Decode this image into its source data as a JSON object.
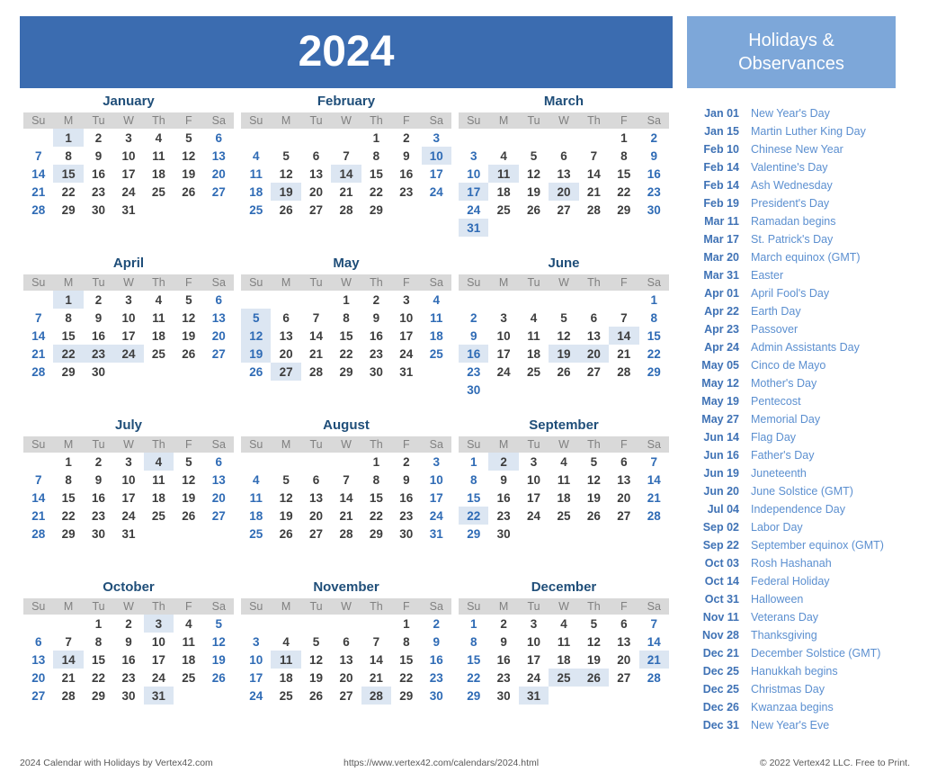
{
  "header": {
    "year": "2024"
  },
  "sidebar": {
    "title_line1": "Holidays &",
    "title_line2": "Observances",
    "holidays": [
      {
        "date": "Jan 01",
        "name": "New Year's Day"
      },
      {
        "date": "Jan 15",
        "name": "Martin Luther King Day"
      },
      {
        "date": "Feb 10",
        "name": "Chinese New Year"
      },
      {
        "date": "Feb 14",
        "name": "Valentine's Day"
      },
      {
        "date": "Feb 14",
        "name": "Ash Wednesday"
      },
      {
        "date": "Feb 19",
        "name": "President's Day"
      },
      {
        "date": "Mar 11",
        "name": "Ramadan begins"
      },
      {
        "date": "Mar 17",
        "name": "St. Patrick's Day"
      },
      {
        "date": "Mar 20",
        "name": "March equinox (GMT)"
      },
      {
        "date": "Mar 31",
        "name": "Easter"
      },
      {
        "date": "Apr 01",
        "name": "April Fool's Day"
      },
      {
        "date": "Apr 22",
        "name": "Earth Day"
      },
      {
        "date": "Apr 23",
        "name": "Passover"
      },
      {
        "date": "Apr 24",
        "name": "Admin Assistants Day"
      },
      {
        "date": "May 05",
        "name": "Cinco de Mayo"
      },
      {
        "date": "May 12",
        "name": "Mother's Day"
      },
      {
        "date": "May 19",
        "name": "Pentecost"
      },
      {
        "date": "May 27",
        "name": "Memorial Day"
      },
      {
        "date": "Jun 14",
        "name": "Flag Day"
      },
      {
        "date": "Jun 16",
        "name": "Father's Day"
      },
      {
        "date": "Jun 19",
        "name": "Juneteenth"
      },
      {
        "date": "Jun 20",
        "name": "June Solstice (GMT)"
      },
      {
        "date": "Jul 04",
        "name": "Independence Day"
      },
      {
        "date": "Sep 02",
        "name": "Labor Day"
      },
      {
        "date": "Sep 22",
        "name": "September equinox (GMT)"
      },
      {
        "date": "Oct 03",
        "name": "Rosh Hashanah"
      },
      {
        "date": "Oct 14",
        "name": "Federal Holiday"
      },
      {
        "date": "Oct 31",
        "name": "Halloween"
      },
      {
        "date": "Nov 11",
        "name": "Veterans Day"
      },
      {
        "date": "Nov 28",
        "name": "Thanksgiving"
      },
      {
        "date": "Dec 21",
        "name": "December Solstice (GMT)"
      },
      {
        "date": "Dec 25",
        "name": "Hanukkah begins"
      },
      {
        "date": "Dec 25",
        "name": "Christmas Day"
      },
      {
        "date": "Dec 26",
        "name": "Kwanzaa begins"
      },
      {
        "date": "Dec 31",
        "name": "New Year's Eve"
      }
    ]
  },
  "calendar": {
    "weekday_headers": [
      "Su",
      "M",
      "Tu",
      "W",
      "Th",
      "F",
      "Sa"
    ],
    "months": [
      {
        "name": "January",
        "first_weekday": 1,
        "days": 31,
        "highlighted": [
          1,
          15
        ]
      },
      {
        "name": "February",
        "first_weekday": 4,
        "days": 29,
        "highlighted": [
          10,
          14,
          19
        ]
      },
      {
        "name": "March",
        "first_weekday": 5,
        "days": 31,
        "highlighted": [
          11,
          17,
          20,
          31
        ]
      },
      {
        "name": "April",
        "first_weekday": 1,
        "days": 30,
        "highlighted": [
          1,
          22,
          23,
          24
        ]
      },
      {
        "name": "May",
        "first_weekday": 3,
        "days": 31,
        "highlighted": [
          5,
          12,
          19,
          27
        ]
      },
      {
        "name": "June",
        "first_weekday": 6,
        "days": 30,
        "highlighted": [
          14,
          16,
          19,
          20
        ]
      },
      {
        "name": "July",
        "first_weekday": 1,
        "days": 31,
        "highlighted": [
          4
        ]
      },
      {
        "name": "August",
        "first_weekday": 4,
        "days": 31,
        "highlighted": []
      },
      {
        "name": "September",
        "first_weekday": 0,
        "days": 30,
        "highlighted": [
          2,
          22
        ]
      },
      {
        "name": "October",
        "first_weekday": 2,
        "days": 31,
        "highlighted": [
          3,
          14,
          31
        ]
      },
      {
        "name": "November",
        "first_weekday": 5,
        "days": 30,
        "highlighted": [
          11,
          28
        ]
      },
      {
        "name": "December",
        "first_weekday": 0,
        "days": 31,
        "highlighted": [
          21,
          25,
          26,
          31
        ]
      }
    ]
  },
  "footer": {
    "left": "2024 Calendar with Holidays by Vertex42.com",
    "middle": "https://www.vertex42.com/calendars/2024.html",
    "right": "© 2022 Vertex42 LLC. Free to Print."
  },
  "colors": {
    "year_banner": "#3b6cb0",
    "holidays_banner": "#7da7d9",
    "month_title": "#1f4e79",
    "weekend_day": "#2f6bb5",
    "weekday": "#3d3d3d",
    "highlight": "#dce6f2",
    "weekday_header_bg": "#d9d9d9"
  }
}
